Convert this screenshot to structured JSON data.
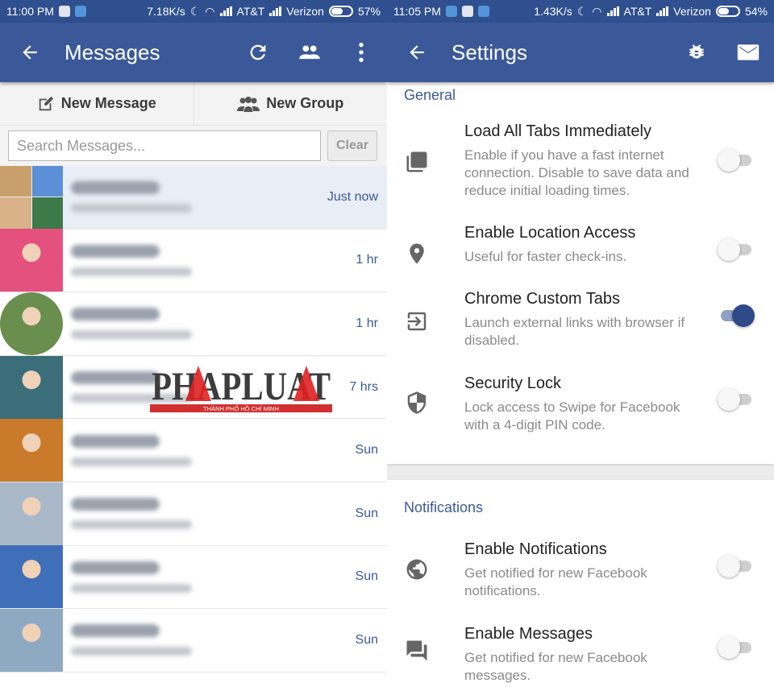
{
  "left": {
    "status": {
      "time": "11:00 PM",
      "speed": "7.18K/s",
      "carrier1": "AT&T",
      "carrier2": "Verizon",
      "battery": "57%",
      "battery_level": 0.57
    },
    "appbar": {
      "title": "Messages",
      "back_icon": "arrow-left-icon",
      "actions": [
        "refresh-icon",
        "people-icon",
        "more-vert-icon"
      ]
    },
    "actions": {
      "new_message": "New Message",
      "new_group": "New Group"
    },
    "search": {
      "placeholder": "Search Messages...",
      "clear": "Clear"
    },
    "conversations": [
      {
        "time": "Just now",
        "avatar_colors": [
          "#c9a06b",
          "#5b8fd6",
          "#d9b28a",
          "#3d7a4a"
        ]
      },
      {
        "time": "1 hr",
        "avatar_colors": [
          "#e4517e"
        ]
      },
      {
        "time": "1 hr",
        "avatar_colors": [
          "#6a8e4e"
        ]
      },
      {
        "time": "7 hrs",
        "avatar_colors": [
          "#3c6e7a"
        ]
      },
      {
        "time": "Sun",
        "avatar_colors": [
          "#c97a2b"
        ]
      },
      {
        "time": "Sun",
        "avatar_colors": [
          "#a9b9c9"
        ]
      },
      {
        "time": "Sun",
        "avatar_colors": [
          "#3f6fb8"
        ]
      },
      {
        "time": "Sun",
        "avatar_colors": [
          "#8ea9c2"
        ]
      }
    ],
    "watermark": {
      "brand": "PHAPLUAT",
      "tagline": "THÀNH PHỐ HỒ CHÍ MINH"
    }
  },
  "right": {
    "status": {
      "time": "11:05 PM",
      "speed": "1.43K/s",
      "carrier1": "AT&T",
      "carrier2": "Verizon",
      "battery": "54%",
      "battery_level": 0.54
    },
    "appbar": {
      "title": "Settings",
      "back_icon": "arrow-left-icon",
      "actions": [
        "bug-icon",
        "mail-icon"
      ]
    },
    "general": {
      "label": "General",
      "items": [
        {
          "title": "Load All Tabs Immediately",
          "desc": "Enable if you have a fast internet connection. Disable to save data and reduce initial loading times.",
          "icon": "layers-icon",
          "enabled": false
        },
        {
          "title": "Enable Location Access",
          "desc": "Useful for faster check-ins.",
          "icon": "location-pin-icon",
          "enabled": false
        },
        {
          "title": "Chrome Custom Tabs",
          "desc": "Launch external links with browser if disabled.",
          "icon": "exit-to-app-icon",
          "enabled": true
        },
        {
          "title": "Security Lock",
          "desc": "Lock access to Swipe for Facebook with a 4-digit PIN code.",
          "icon": "shield-icon",
          "enabled": false
        }
      ]
    },
    "notifications": {
      "label": "Notifications",
      "items": [
        {
          "title": "Enable Notifications",
          "desc": "Get notified for new Facebook notifications.",
          "icon": "globe-icon",
          "enabled": false
        },
        {
          "title": "Enable Messages",
          "desc": "Get notified for new Facebook messages.",
          "icon": "chat-icon",
          "enabled": false
        }
      ]
    }
  },
  "colors": {
    "brand": "#3b5998",
    "statusbar": "#2f4f8f",
    "toggle_on": "#2e4a88"
  }
}
